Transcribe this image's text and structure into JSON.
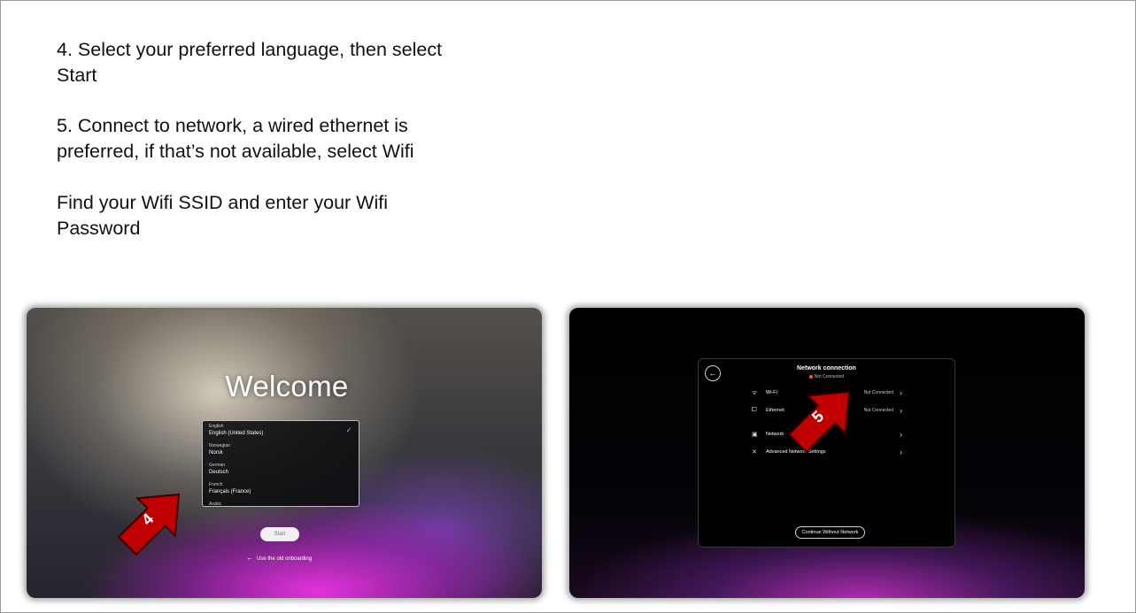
{
  "instructions": {
    "step4": "4. Select your preferred language, then select Start",
    "step5": "5. Connect to network, a wired ethernet is preferred, if that’s not available, select Wifi",
    "wifi_note": "Find your Wifi SSID and enter your Wifi Password"
  },
  "welcome_screen": {
    "title": "Welcome",
    "languages": [
      {
        "label": "English",
        "native": "English (United States)",
        "selected": true
      },
      {
        "label": "Norwegian",
        "native": "Norsk"
      },
      {
        "label": "German",
        "native": "Deutsch"
      },
      {
        "label": "French",
        "native": "Français (France)"
      },
      {
        "label": "Arabic",
        "native": ""
      }
    ],
    "start_label": "Start",
    "old_onboarding_label": "Use the old onboarding",
    "callout_number": "4"
  },
  "network_screen": {
    "title": "Network connection",
    "status": "Not Connected",
    "rows": [
      {
        "icon": "wifi-icon",
        "label": "Wi-Fi",
        "value": "Not Connected"
      },
      {
        "icon": "ethernet-icon",
        "label": "Ethernet",
        "value": "Not Connected"
      },
      {
        "icon": "network-icon",
        "label": "Network",
        "value": ""
      },
      {
        "icon": "tools-icon",
        "label": "Advanced Network Settings",
        "value": ""
      }
    ],
    "continue_label": "Continue Without Network",
    "callout_number": "5"
  },
  "colors": {
    "callout_fill": "#c00000",
    "callout_stroke": "#3a0000",
    "status_dot": "#ff4a3d",
    "check": "#5fb3ff"
  }
}
